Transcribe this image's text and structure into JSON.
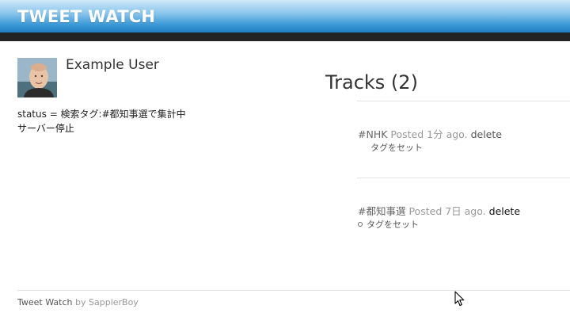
{
  "header": {
    "app_title": "TWEET WATCH"
  },
  "user": {
    "name": "Example User",
    "avatar_icon": "user-avatar-photo"
  },
  "status": {
    "line": "status = 検索タグ:#都知事選で集計中",
    "server": "サーバー停止"
  },
  "tracks": {
    "heading": "Tracks (2)",
    "items": [
      {
        "hashtag": "#NHK",
        "posted": "Posted 1分 ago.",
        "delete_label": "delete",
        "set_tag_label": "タグをセット"
      },
      {
        "hashtag": "#都知事選",
        "posted": "Posted 7日 ago.",
        "delete_label": "delete",
        "set_tag_label": "タグをセット"
      }
    ]
  },
  "footer": {
    "app_name": "Tweet Watch",
    "by_label": "by",
    "author": "SappierBoy"
  },
  "colors": {
    "header_gradient_top": "#cfe8f8",
    "header_gradient_bottom": "#1f7fc4",
    "header_bar": "#232323"
  }
}
